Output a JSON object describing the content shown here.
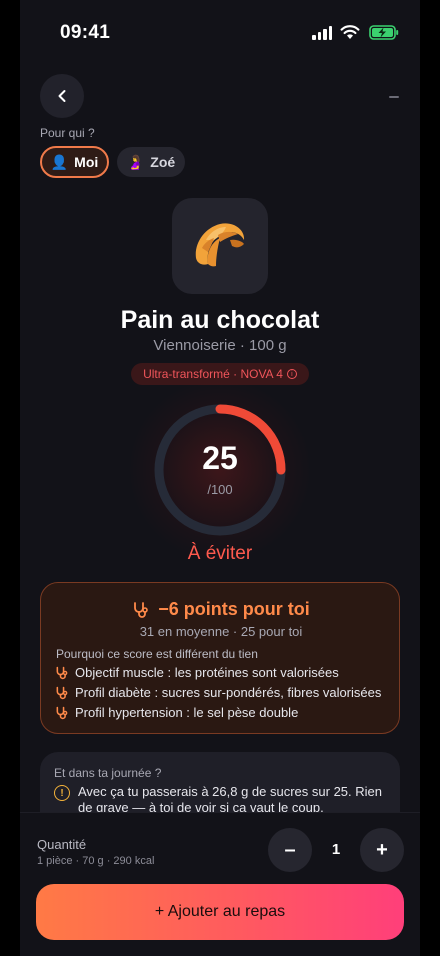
{
  "status": {
    "time": "09:41"
  },
  "profile": {
    "label": "Pour qui ?",
    "options": [
      {
        "emoji": "👤",
        "name": "Moi",
        "selected": true
      },
      {
        "emoji": "🤰",
        "name": "Zoé",
        "selected": false
      }
    ]
  },
  "food": {
    "emoji": "🥐",
    "name": "Pain au chocolat",
    "subtitle": "Viennoiserie · 100 g",
    "nova_badge": "Ultra-transformé · NOVA 4",
    "score": "25",
    "score_max": "/100",
    "score_fraction": 0.25,
    "verdict": "À éviter"
  },
  "impact": {
    "headline": "−6 points pour toi",
    "detail": "31 en moyenne · 25 pour toi",
    "why_label": "Pourquoi ce score est différent du tien",
    "reasons": [
      "Objectif muscle : les protéines sont valorisées",
      "Profil diabète : sucres sur-pondérés, fibres valorisées",
      "Profil hypertension : le sel pèse double"
    ]
  },
  "day": {
    "label": "Et dans ta journée ?",
    "text": "Avec ça tu passerais à 26,8 g de sucres sur 25. Rien de grave — à toi de voir si ça vaut le coup."
  },
  "quantity": {
    "label": "Quantité",
    "detail": "1 pièce · 70 g · 290 kcal",
    "value": "1",
    "minus": "–",
    "plus": "+"
  },
  "cta": {
    "label": "+ Ajouter au repas"
  },
  "colors": {
    "accent": "#ff7a45",
    "danger": "#ff5a4e",
    "background": "#121218"
  }
}
